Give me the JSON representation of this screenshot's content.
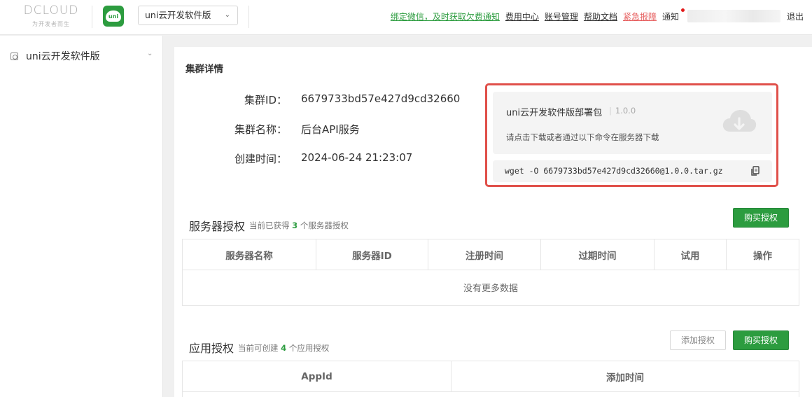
{
  "header": {
    "logo_text": "DCLOUD",
    "logo_slogan": "为开发者而生",
    "uni_badge": "uni",
    "app_select_value": "uni云开发软件版",
    "links": {
      "bind_wechat": "绑定微信，及时获取欠费通知",
      "billing": "费用中心",
      "account": "账号管理",
      "help": "帮助文档",
      "emergency": "紧急报障"
    },
    "notice": "通知",
    "logout": "退出"
  },
  "sidebar": {
    "items": [
      {
        "label": "uni云开发软件版"
      }
    ]
  },
  "cluster": {
    "title": "集群详情",
    "id_label": "集群ID：",
    "id_value": "6679733bd57e427d9cd32660",
    "name_label": "集群名称：",
    "name_value": "后台API服务",
    "created_label": "创建时间：",
    "created_value": "2024-06-24 21:23:07"
  },
  "package": {
    "name": "uni云开发软件版部署包",
    "version": "1.0.0",
    "description": "请点击下载或者通过以下命令在服务器下载",
    "command": "wget -O 6679733bd57e427d9cd32660@1.0.0.tar.gz"
  },
  "server_license": {
    "title": "服务器授权",
    "sub_prefix": "当前已获得",
    "count": "3",
    "sub_suffix": "个服务器授权",
    "buy_button": "购买授权",
    "columns": [
      "服务器名称",
      "服务器ID",
      "注册时间",
      "过期时间",
      "试用",
      "操作"
    ],
    "empty_text": "没有更多数据"
  },
  "app_license": {
    "title": "应用授权",
    "sub_prefix": "当前可创建",
    "count": "4",
    "sub_suffix": "个应用授权",
    "add_button": "添加授权",
    "buy_button": "购买授权",
    "columns": [
      "AppId",
      "添加时间"
    ]
  },
  "colors": {
    "brand_green": "#2c9c3f",
    "highlight_red": "#e0504a",
    "emergency_red": "#e65d5d"
  }
}
